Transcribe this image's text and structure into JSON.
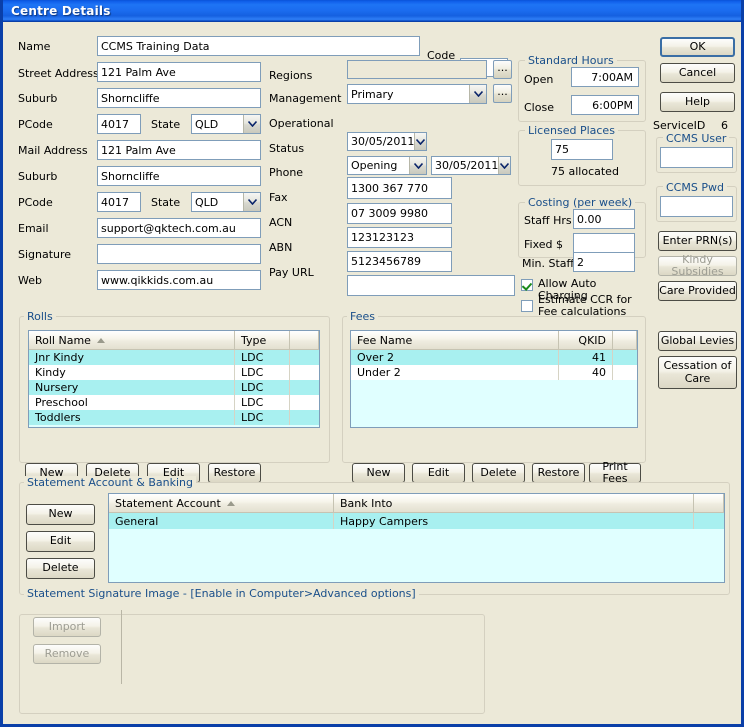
{
  "window": {
    "title": "Centre Details"
  },
  "left_form": {
    "fields": [
      {
        "label": "Name",
        "value": "CCMS Training Data"
      },
      {
        "label": "Street Address",
        "value": "121 Palm Ave"
      },
      {
        "label": "Suburb",
        "value": "Shorncliffe"
      },
      {
        "label": "PCode",
        "value": "4017"
      },
      {
        "label": "Mail Address",
        "value": "121 Palm Ave"
      },
      {
        "label": "Suburb",
        "value": "Shorncliffe"
      },
      {
        "label": "PCode",
        "value": "4017"
      },
      {
        "label": "Email",
        "value": "support@qktech.com.au"
      },
      {
        "label": "Signature",
        "value": ""
      },
      {
        "label": "Web",
        "value": "www.qikkids.com.au"
      }
    ],
    "state_label_1": "State",
    "state_value_1": "QLD",
    "state_label_2": "State",
    "state_value_2": "QLD",
    "code_label": "Code",
    "code_value": ""
  },
  "mid_form": {
    "regions_label": "Regions",
    "regions_value": "",
    "regions_browse": "...",
    "management_label": "Management",
    "management_value": "Primary",
    "management_browse": "...",
    "operational_label": "Operational",
    "operational_value": "30/05/2011",
    "status_label": "Status",
    "status_value": "Opening",
    "status_date": "30/05/2011",
    "phone_label": "Phone",
    "phone_value": "1300 367 770",
    "fax_label": "Fax",
    "fax_value": "07 3009 9980",
    "acn_label": "ACN",
    "acn_value": "123123123",
    "abn_label": "ABN",
    "abn_value": "5123456789",
    "payurl_label": "Pay URL",
    "payurl_value": ""
  },
  "standard_hours": {
    "title": "Standard Hours",
    "open_label": "Open",
    "open_value": "7:00AM",
    "close_label": "Close",
    "close_value": "6:00PM"
  },
  "licensed_places": {
    "title": "Licensed Places",
    "value": "75",
    "allocated_text": "75 allocated"
  },
  "costing": {
    "title": "Costing (per week)",
    "staff_hrs_label": "Staff Hrs",
    "staff_hrs_value": "0.00",
    "fixed_label": "Fixed $",
    "fixed_value": ""
  },
  "min_staff": {
    "label": "Min. Staff",
    "value": "2"
  },
  "checkboxes": [
    {
      "label": "Allow Auto Charging",
      "checked": true
    },
    {
      "label": "Estimate CCR for Fee calculations",
      "checked": false
    }
  ],
  "right_panel": {
    "ok_label": "OK",
    "cancel_label": "Cancel",
    "help_label": "Help",
    "service_id_label": "ServiceID",
    "service_id_value": "6",
    "ccms_user_title": "CCMS User",
    "ccms_user_value": "",
    "ccms_pwd_title": "CCMS Pwd",
    "ccms_pwd_value": "",
    "enter_prn_label": "Enter PRN(s)",
    "kindy_subsidies_label": "Kindy Subsidies",
    "care_provided_label": "Care Provided",
    "global_levies_label": "Global Levies",
    "cessation_label": "Cessation of Care"
  },
  "rolls": {
    "title": "Rolls",
    "columns": [
      "Roll Name",
      "Type"
    ],
    "rows": [
      {
        "name": "Jnr Kindy",
        "type": "LDC"
      },
      {
        "name": "Kindy",
        "type": "LDC"
      },
      {
        "name": "Nursery",
        "type": "LDC"
      },
      {
        "name": "Preschool",
        "type": "LDC"
      },
      {
        "name": "Toddlers",
        "type": "LDC"
      }
    ],
    "buttons": [
      "New",
      "Delete",
      "Edit",
      "Restore"
    ]
  },
  "fees": {
    "title": "Fees",
    "columns": [
      "Fee Name",
      "QKID"
    ],
    "rows": [
      {
        "name": "Over 2",
        "qkid": "41"
      },
      {
        "name": "Under 2",
        "qkid": "40"
      }
    ],
    "buttons": [
      "New",
      "Edit",
      "Delete",
      "Restore",
      "Print Fees"
    ]
  },
  "statement": {
    "title": "Statement Account & Banking",
    "buttons": [
      "New",
      "Edit",
      "Delete"
    ],
    "columns": [
      "Statement Account",
      "Bank Into"
    ],
    "rows": [
      {
        "account": "General",
        "bank": "Happy Campers"
      }
    ]
  },
  "signature": {
    "title": "Statement Signature Image - [Enable in Computer>Advanced options]",
    "import_label": "Import",
    "remove_label": "Remove"
  },
  "icons": {
    "dropdown": "chevron-down-icon",
    "sort_asc": "sort-ascending-icon"
  },
  "colors": {
    "title_blue": "#1b6cef",
    "face": "#ece9d8",
    "grid_bg": "#e0ffff",
    "selection": "#a8f0f0",
    "group_label": "#1a4f8a"
  }
}
